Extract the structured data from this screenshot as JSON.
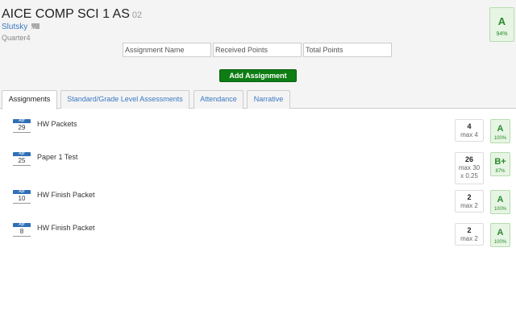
{
  "course": {
    "title": "AICE COMP SCI 1 AS",
    "period": "02",
    "teacher": "Slutsky",
    "term": "Quarter4",
    "overall_grade": "A",
    "overall_percent": "94%"
  },
  "form": {
    "name_placeholder": "Assignment Name",
    "received_placeholder": "Received Points",
    "total_placeholder": "Total Points",
    "add_label": "Add Assignment"
  },
  "tabs": [
    {
      "label": "Assignments",
      "active": true
    },
    {
      "label": "Standard/Grade Level Assessments",
      "active": false
    },
    {
      "label": "Attendance",
      "active": false
    },
    {
      "label": "Narrative",
      "active": false
    }
  ],
  "assignments": [
    {
      "month": "Apr",
      "day": "29",
      "name": "HW Packets",
      "earned": "4",
      "max": "max 4",
      "weight": "",
      "grade": "A",
      "percent": "100%"
    },
    {
      "month": "Apr",
      "day": "25",
      "name": "Paper 1 Test",
      "earned": "26",
      "max": "max 30",
      "weight": "x 0.25",
      "grade": "B+",
      "percent": "87%"
    },
    {
      "month": "Apr",
      "day": "10",
      "name": "HW Finish Packet",
      "earned": "2",
      "max": "max 2",
      "weight": "",
      "grade": "A",
      "percent": "100%"
    },
    {
      "month": "Apr",
      "day": "8",
      "name": "HW Finish Packet",
      "earned": "2",
      "max": "max 2",
      "weight": "",
      "grade": "A",
      "percent": "100%"
    }
  ],
  "colors": {
    "accent": "#3a78c2",
    "add_button": "#0e7d14",
    "grade_green": "#2a8c2a",
    "grade_bg": "#e7f5e4",
    "date_badge": "#2f6fb5"
  }
}
